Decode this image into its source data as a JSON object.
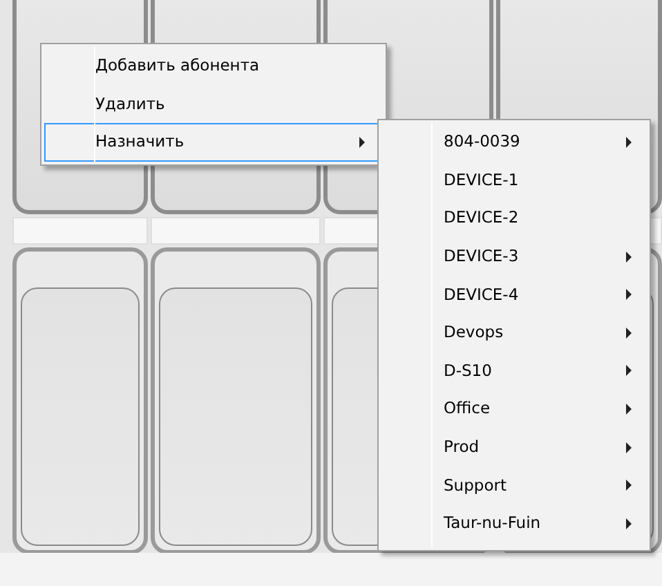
{
  "context_menu": {
    "items": [
      {
        "label": "Добавить абонента",
        "has_submenu": false,
        "selected": false
      },
      {
        "label": "Удалить",
        "has_submenu": false,
        "selected": false
      },
      {
        "label": "Назначить",
        "has_submenu": true,
        "selected": true
      }
    ]
  },
  "submenu": {
    "items": [
      {
        "label": "804-0039",
        "has_submenu": true
      },
      {
        "label": "DEVICE-1",
        "has_submenu": false
      },
      {
        "label": "DEVICE-2",
        "has_submenu": false
      },
      {
        "label": "DEVICE-3",
        "has_submenu": true
      },
      {
        "label": "DEVICE-4",
        "has_submenu": true
      },
      {
        "label": "Devops",
        "has_submenu": true
      },
      {
        "label": "D-S10",
        "has_submenu": true
      },
      {
        "label": "Office",
        "has_submenu": true
      },
      {
        "label": "Prod",
        "has_submenu": true
      },
      {
        "label": "Support",
        "has_submenu": true
      },
      {
        "label": "Taur-nu-Fuin",
        "has_submenu": true
      }
    ]
  }
}
